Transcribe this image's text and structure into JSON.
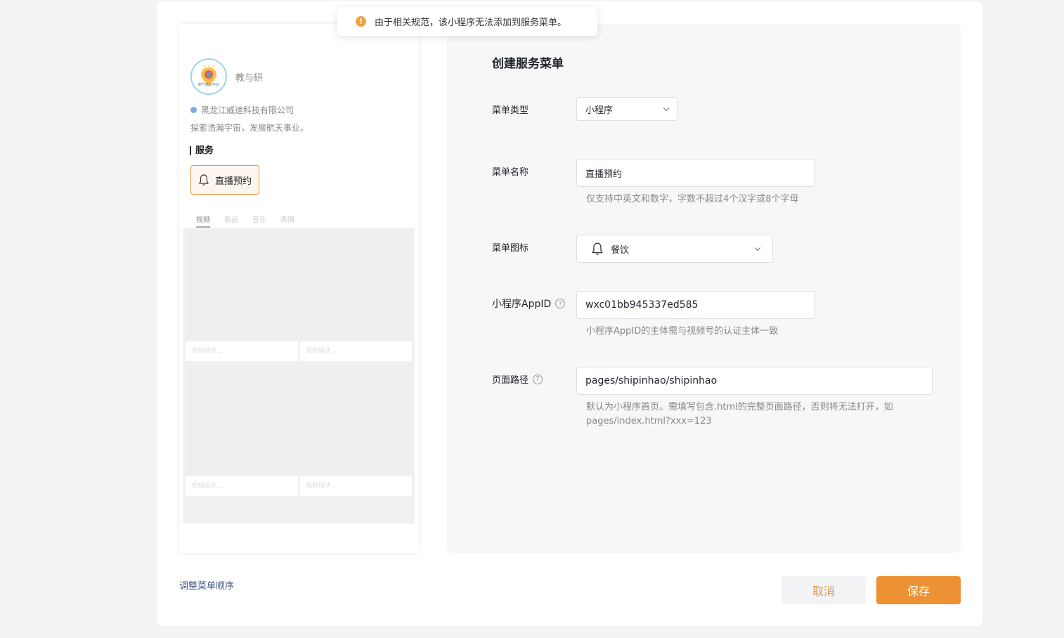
{
  "toast": {
    "icon": "warning-icon",
    "text": "由于相关规范，该小程序无法添加到服务菜单。"
  },
  "preview": {
    "avatar_caption": "新气象云平台",
    "name": "教与研",
    "company": "黑龙江威速科技有限公司",
    "bio": "探索浩瀚宇宙，发展航天事业。",
    "service_heading": "服务",
    "service_button": "直播预约",
    "tabs": [
      "视频",
      "商品",
      "音乐",
      "表情"
    ],
    "tile_caption": "视频描述..."
  },
  "reorder_link": "调整菜单顺序",
  "form": {
    "title": "创建服务菜单",
    "menu_type": {
      "label": "菜单类型",
      "value": "小程序"
    },
    "menu_name": {
      "label": "菜单名称",
      "value": "直播预约",
      "hint": "仅支持中英文和数字，字数不超过4个汉字或8个字母"
    },
    "menu_icon": {
      "label": "菜单图标",
      "value": "餐饮",
      "icon": "bell-icon"
    },
    "appid": {
      "label": "小程序AppID",
      "value": "wxc01bb945337ed585",
      "hint": "小程序AppID的主体需与视频号的认证主体一致"
    },
    "page_path": {
      "label": "页面路径",
      "value": "pages/shipinhao/shipinhao",
      "hint_line1": "默认为小程序首页。需填写包含.html的完整页面路径，否则将无法打开，如",
      "hint_line2": "pages/index.html?xxx=123"
    }
  },
  "buttons": {
    "cancel": "取消",
    "save": "保存"
  },
  "colors": {
    "accent": "#ed9135",
    "warning": "#f1a13d",
    "link": "#41598a"
  }
}
